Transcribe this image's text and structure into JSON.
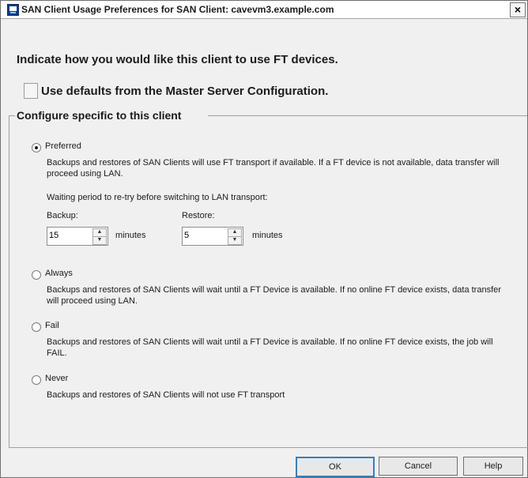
{
  "window": {
    "title": "SAN Client Usage Preferences for SAN Client:  cavevm3.example.com",
    "close_label": "×"
  },
  "heading": "Indicate how you would like this client to use FT devices.",
  "defaults_checkbox": {
    "label": "Use defaults from the Master Server Configuration.",
    "checked": false
  },
  "group": {
    "title": "Configure specific to this client",
    "options": [
      {
        "key": "preferred",
        "label": "Preferred",
        "selected": true,
        "description": "Backups and restores of SAN Clients will use FT transport if available. If a FT device is not available, data transfer will proceed using LAN."
      },
      {
        "key": "always",
        "label": "Always",
        "selected": false,
        "description": "Backups and restores of SAN Clients will wait until a FT Device is available. If no online FT device exists, data transfer will proceed using LAN."
      },
      {
        "key": "fail",
        "label": "Fail",
        "selected": false,
        "description": "Backups and restores of SAN Clients will wait until a FT Device is available. If no online FT device exists, the job will FAIL."
      },
      {
        "key": "never",
        "label": "Never",
        "selected": false,
        "description": "Backups and restores of SAN Clients will not use FT transport"
      }
    ],
    "waiting": {
      "label": "Waiting period to re-try before switching to LAN transport:",
      "backup_label": "Backup:",
      "backup_value": "15",
      "restore_label": "Restore:",
      "restore_value": "5",
      "units": "minutes"
    }
  },
  "buttons": {
    "ok": "OK",
    "cancel": "Cancel",
    "help": "Help"
  }
}
